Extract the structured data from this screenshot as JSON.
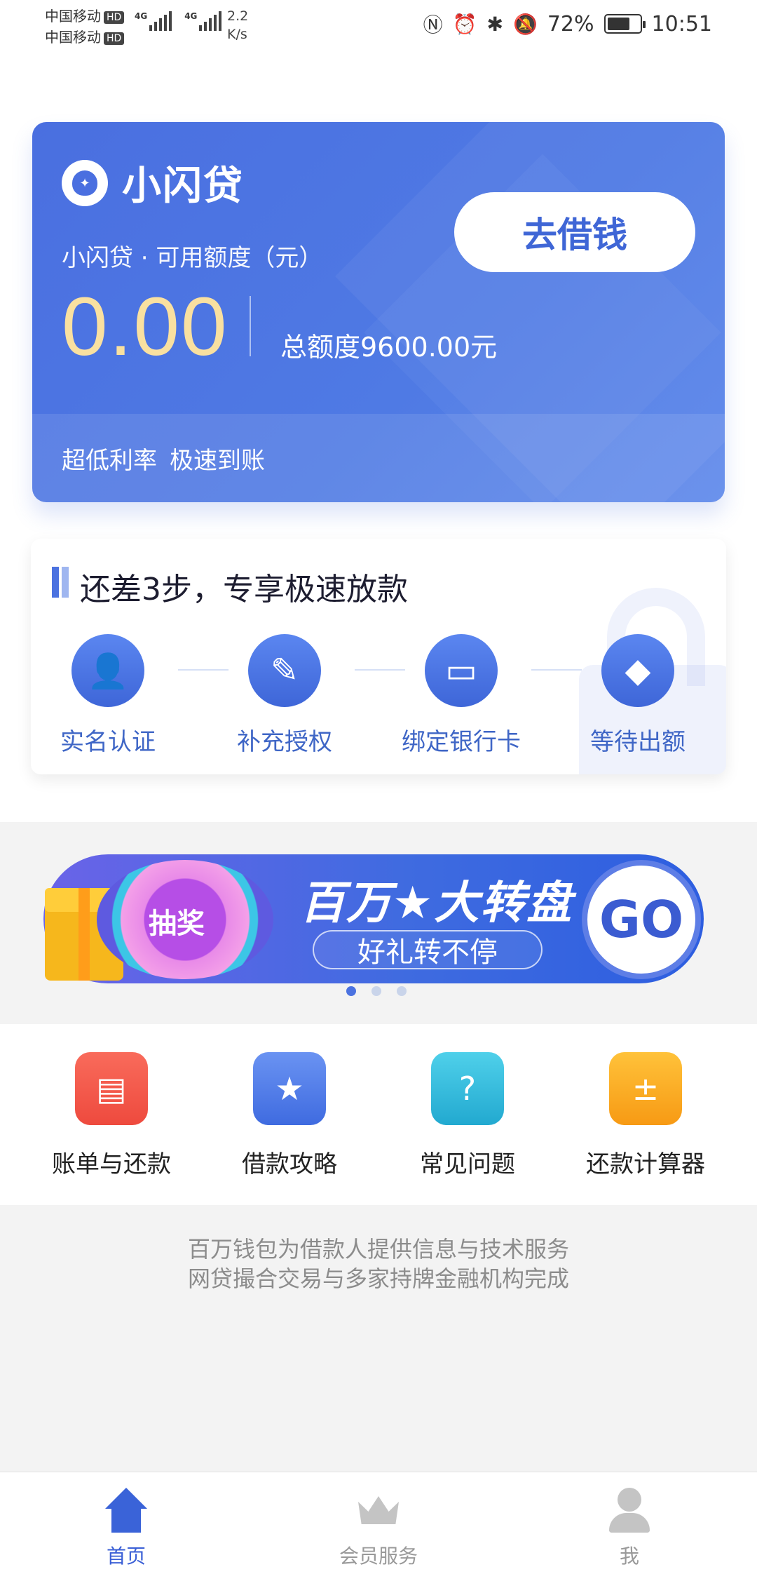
{
  "status_bar": {
    "carrier1": "中国移动",
    "carrier2": "中国移动",
    "hd": "HD",
    "network": "4G",
    "speed_value": "2.2",
    "speed_unit": "K/s",
    "battery": "72%",
    "time": "10:51"
  },
  "loan_card": {
    "brand": "小闪贷",
    "subtitle": "小闪贷 · 可用额度（元）",
    "amount": "0.00",
    "total": "总额度9600.00元",
    "borrow_button": "去借钱",
    "feature1": "超低利率",
    "feature2": "极速到账"
  },
  "steps": {
    "title": "还差3步，专享极速放款",
    "items": [
      {
        "label": "实名认证",
        "icon": "person-icon"
      },
      {
        "label": "补充授权",
        "icon": "pen-icon"
      },
      {
        "label": "绑定银行卡",
        "icon": "bank-card-icon"
      },
      {
        "label": "等待出额",
        "icon": "money-bag-icon"
      }
    ]
  },
  "banner": {
    "wheel_label": "抽奖",
    "title": "百万★大转盘",
    "subtitle": "好礼转不停",
    "go": "GO",
    "page_count": 3,
    "active_index": 0
  },
  "quick_menu": [
    {
      "label": "账单与还款",
      "icon": "bill-icon",
      "color": "#f2584a"
    },
    {
      "label": "借款攻略",
      "icon": "guide-book-icon",
      "color": "#4a78e8"
    },
    {
      "label": "常见问题",
      "icon": "question-icon",
      "color": "#2fb7d8"
    },
    {
      "label": "还款计算器",
      "icon": "calculator-icon",
      "color": "#f8a820"
    }
  ],
  "disclaimer": {
    "line1": "百万钱包为借款人提供信息与技术服务",
    "line2": "网贷撮合交易与多家持牌金融机构完成"
  },
  "tab_bar": [
    {
      "label": "首页",
      "icon": "home-icon",
      "active": true
    },
    {
      "label": "会员服务",
      "icon": "crown-icon",
      "active": false
    },
    {
      "label": "我",
      "icon": "profile-icon",
      "active": false
    }
  ],
  "colors": {
    "primary": "#4a6fe0",
    "amount": "#f9e0a0"
  }
}
